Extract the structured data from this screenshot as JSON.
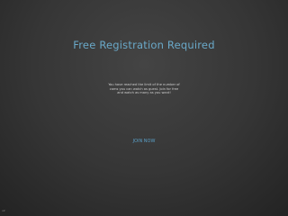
{
  "modal": {
    "title": "Free Registration Required",
    "message": "You have reached the limit of the number of cams you can watch as guest. Join for free and watch as many as you want!",
    "join_label": "JOIN NOW"
  },
  "footer": {
    "corner_text": "v2"
  }
}
